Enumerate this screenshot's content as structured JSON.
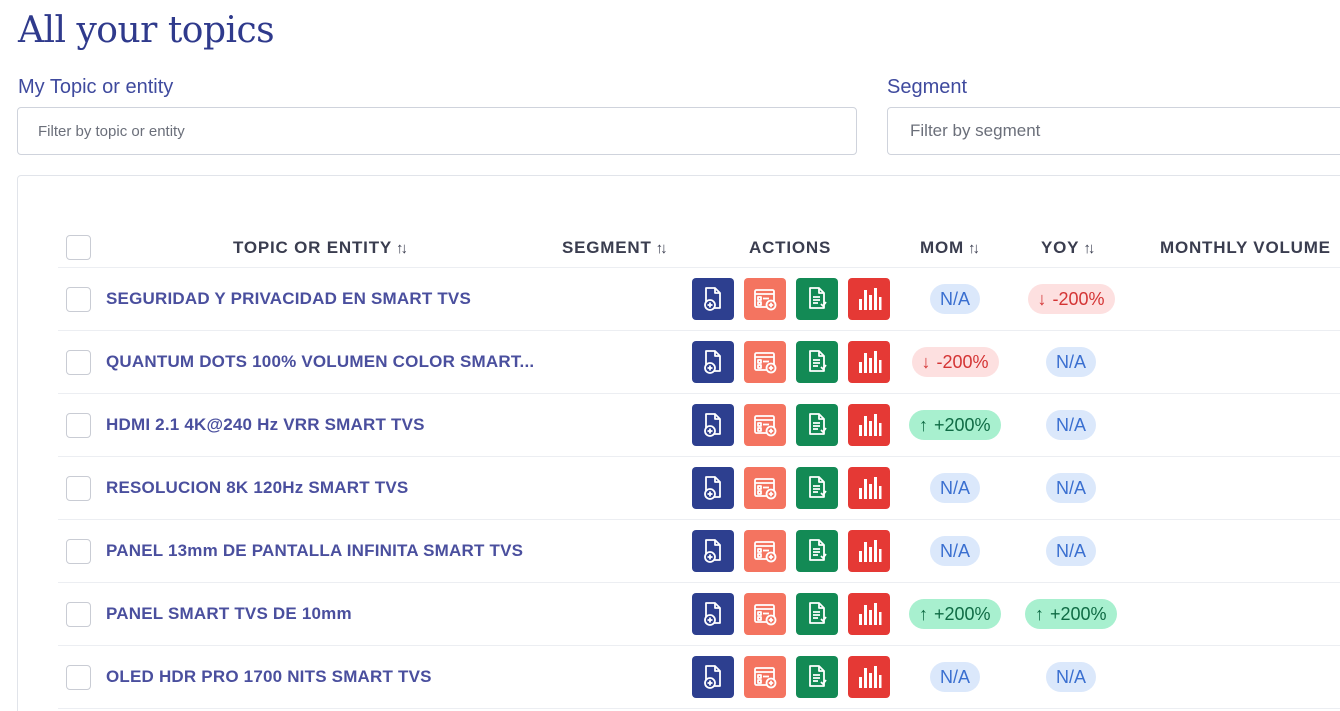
{
  "page": {
    "title": "All your topics"
  },
  "filters": {
    "topic": {
      "label": "My Topic or entity",
      "placeholder": "Filter by topic or entity"
    },
    "segment": {
      "label": "Segment",
      "placeholder": "Filter by segment"
    }
  },
  "table": {
    "columns": {
      "topic": "TOPIC OR ENTITY",
      "segment": "SEGMENT",
      "actions": "ACTIONS",
      "mom": "MOM",
      "yoy": "YOY",
      "monthly_volume": "MONTHLY VOLUME"
    },
    "sort_icon": "sort-arrows-icon",
    "actions": [
      {
        "name": "add-document",
        "icon": "file-plus-icon",
        "color": "#2d3f8f"
      },
      {
        "name": "add-template",
        "icon": "form-plus-icon",
        "color": "#f47460"
      },
      {
        "name": "sheet-document",
        "icon": "file-sheet-icon",
        "color": "#138a55"
      },
      {
        "name": "chart",
        "icon": "bar-chart-icon",
        "color": "#e53935"
      }
    ],
    "rows": [
      {
        "topic": "SEGURIDAD Y PRIVACIDAD EN SMART TVS",
        "segment": "",
        "mom": {
          "text": "N/A",
          "trend": "na"
        },
        "yoy": {
          "text": "-200%",
          "trend": "down"
        }
      },
      {
        "topic": "QUANTUM DOTS 100% VOLUMEN COLOR SMART...",
        "segment": "",
        "mom": {
          "text": "-200%",
          "trend": "down"
        },
        "yoy": {
          "text": "N/A",
          "trend": "na"
        }
      },
      {
        "topic": "HDMI 2.1 4K@240 Hz VRR SMART TVS",
        "segment": "",
        "mom": {
          "text": "+200%",
          "trend": "up"
        },
        "yoy": {
          "text": "N/A",
          "trend": "na"
        }
      },
      {
        "topic": "RESOLUCION 8K 120Hz SMART TVS",
        "segment": "",
        "mom": {
          "text": "N/A",
          "trend": "na"
        },
        "yoy": {
          "text": "N/A",
          "trend": "na"
        }
      },
      {
        "topic": "PANEL 13mm DE PANTALLA INFINITA SMART TVS",
        "segment": "",
        "mom": {
          "text": "N/A",
          "trend": "na"
        },
        "yoy": {
          "text": "N/A",
          "trend": "na"
        }
      },
      {
        "topic": "PANEL SMART TVS DE 10mm",
        "segment": "",
        "mom": {
          "text": "+200%",
          "trend": "up"
        },
        "yoy": {
          "text": "+200%",
          "trend": "up"
        }
      },
      {
        "topic": "OLED HDR PRO 1700 NITS SMART TVS",
        "segment": "",
        "mom": {
          "text": "N/A",
          "trend": "na"
        },
        "yoy": {
          "text": "N/A",
          "trend": "na"
        }
      }
    ]
  }
}
